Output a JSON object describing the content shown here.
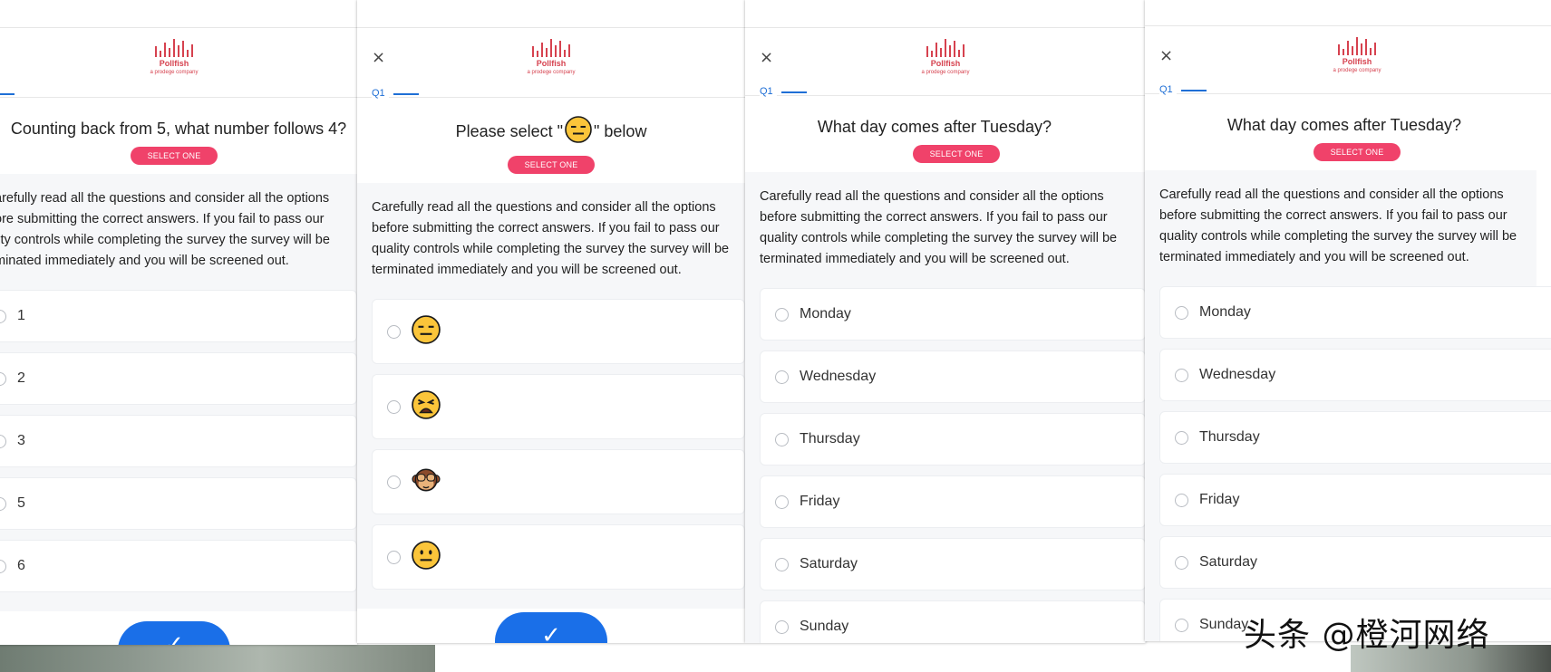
{
  "brand": {
    "name": "Pollfish",
    "tagline": "a prodege company",
    "accent": "#d6424f",
    "pill_color": "#f0426a",
    "primary_blue": "#1a6fe8"
  },
  "common": {
    "close_icon": "×",
    "select_one": "SELECT ONE",
    "note": "Carefully read all the questions and consider all the options before submitting the correct answers. If you fail to pass our quality controls while completing the survey the survey will be terminated immediately and you will be screened out.",
    "submit_icon": "✓"
  },
  "panel1": {
    "question": "Counting back from 5, what number follows 4?",
    "note_visible": "arefully read all the questions and consider all the options\nore submitting the correct answers. If you fail to pass our\nlity controls while completing the survey the survey will be\nminated immediately and you will be screened out.",
    "options": [
      "1",
      "2",
      "3",
      "5",
      "6"
    ]
  },
  "panel2": {
    "q_label": "Q1",
    "question_prefix": "Please select \"",
    "question_suffix": "\" below",
    "question_emoji": "expressionless-face",
    "options": [
      "expressionless-face",
      "weary-face",
      "see-no-evil-monkey",
      "neutral-face"
    ]
  },
  "panel3": {
    "q_label": "Q1",
    "question": "What day comes after Tuesday?",
    "options": [
      "Monday",
      "Wednesday",
      "Thursday",
      "Friday",
      "Saturday",
      "Sunday"
    ]
  },
  "panel4": {
    "q_label": "Q1",
    "question": "What day comes after Tuesday?",
    "options": [
      "Monday",
      "Wednesday",
      "Thursday",
      "Friday",
      "Saturday",
      "Sunday"
    ]
  },
  "watermark": "头条 @橙河网络"
}
